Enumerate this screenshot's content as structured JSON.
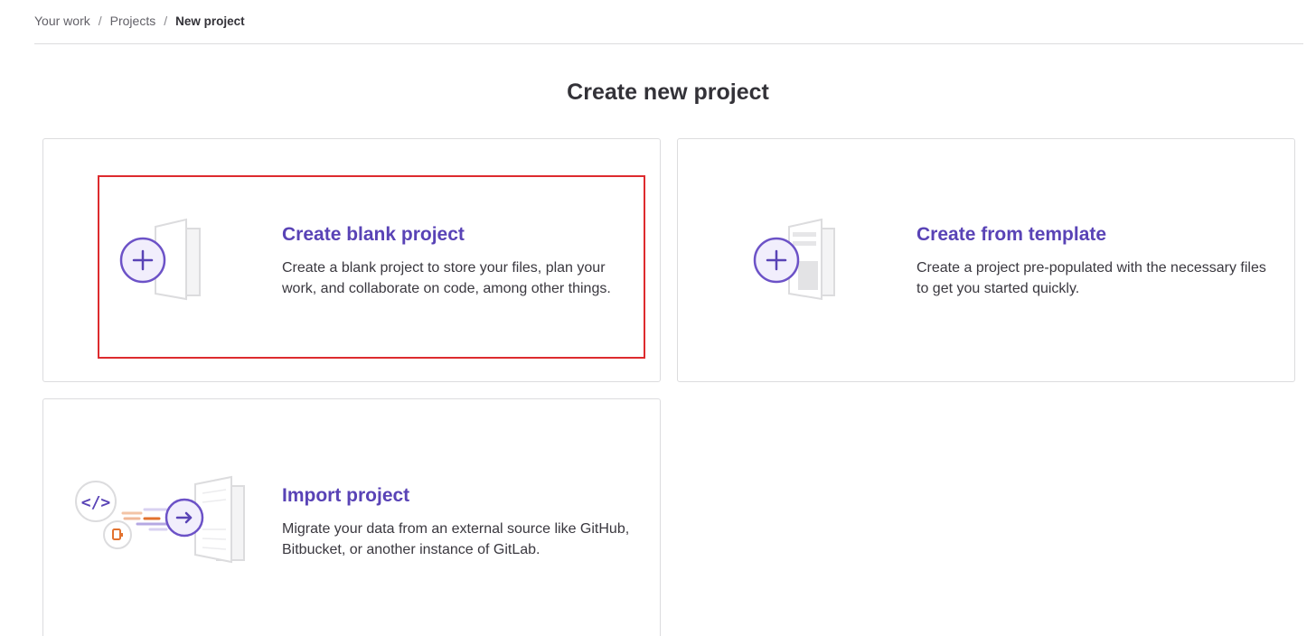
{
  "breadcrumb": {
    "items": [
      "Your work",
      "Projects"
    ],
    "separator": "/",
    "current": "New project"
  },
  "page": {
    "title": "Create new project"
  },
  "options": {
    "blank": {
      "title": "Create blank project",
      "description": "Create a blank project to store your files, plan your work, and collaborate on code, among other things.",
      "icon": "blank-project-illustration"
    },
    "template": {
      "title": "Create from template",
      "description": "Create a project pre-populated with the necessary files to get you started quickly.",
      "icon": "template-project-illustration"
    },
    "import": {
      "title": "Import project",
      "description": "Migrate your data from an external source like GitHub, Bitbucket, or another instance of GitLab.",
      "icon": "import-project-illustration"
    }
  },
  "colors": {
    "accent": "#5943b6",
    "highlight": "#dd2b2e",
    "border": "#dcdcde"
  }
}
